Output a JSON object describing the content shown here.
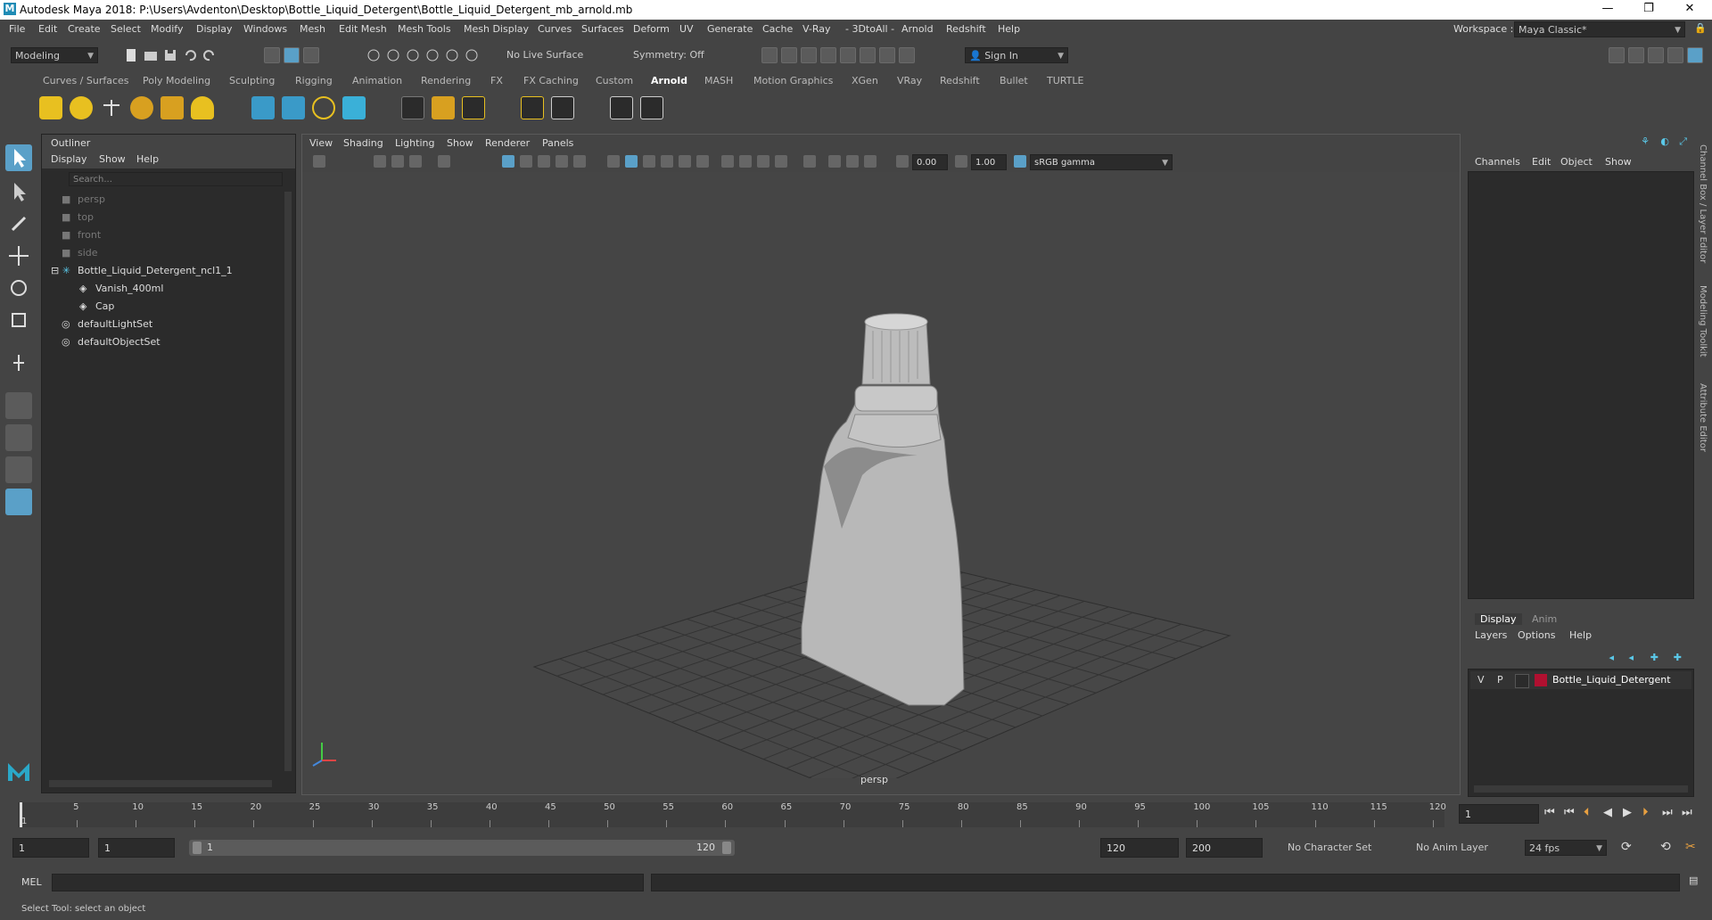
{
  "window": {
    "title": "Autodesk Maya 2018: P:\\Users\\Avdenton\\Desktop\\Bottle_Liquid_Detergent\\Bottle_Liquid_Detergent_mb_arnold.mb",
    "logo": "M",
    "minimize": "—",
    "maximize": "❐",
    "close": "✕"
  },
  "menubar": {
    "items": [
      "File",
      "Edit",
      "Create",
      "Select",
      "Modify",
      "Display",
      "Windows",
      "Mesh",
      "Edit Mesh",
      "Mesh Tools",
      "Mesh Display",
      "Curves",
      "Surfaces",
      "Deform",
      "UV",
      "Generate",
      "Cache",
      "V-Ray",
      "- 3DtoAll -",
      "Arnold",
      "Redshift",
      "Help"
    ],
    "workspace_label": "Workspace :",
    "workspace_value": "Maya Classic*"
  },
  "statusline": {
    "mode": "Modeling",
    "live_surface": "No Live Surface",
    "symmetry": "Symmetry: Off",
    "sign_in": "Sign In"
  },
  "shelf": {
    "tabs": [
      "Curves / Surfaces",
      "Poly Modeling",
      "Sculpting",
      "Rigging",
      "Animation",
      "Rendering",
      "FX",
      "FX Caching",
      "Custom",
      "Arnold",
      "MASH",
      "Motion Graphics",
      "XGen",
      "VRay",
      "Redshift",
      "Bullet",
      "TURTLE"
    ],
    "active_tab": "Arnold"
  },
  "outliner": {
    "title": "Outliner",
    "menus": [
      "Display",
      "Show",
      "Help"
    ],
    "search_placeholder": "Search...",
    "items": [
      {
        "label": "persp",
        "dim": true
      },
      {
        "label": "top",
        "dim": true
      },
      {
        "label": "front",
        "dim": true
      },
      {
        "label": "side",
        "dim": true
      },
      {
        "label": "Bottle_Liquid_Detergent_ncl1_1",
        "dim": false
      },
      {
        "label": "Vanish_400ml",
        "dim": false
      },
      {
        "label": "Cap",
        "dim": false
      },
      {
        "label": "defaultLightSet",
        "dim": false
      },
      {
        "label": "defaultObjectSet",
        "dim": false
      }
    ]
  },
  "viewport": {
    "menus": [
      "View",
      "Shading",
      "Lighting",
      "Show",
      "Renderer",
      "Panels"
    ],
    "exposure": "0.00",
    "gamma": "1.00",
    "color_space": "sRGB gamma",
    "camera_label": "persp"
  },
  "channelbox": {
    "menus": [
      "Channels",
      "Edit",
      "Object",
      "Show"
    ]
  },
  "layereditor": {
    "tabs": [
      "Display",
      "Anim"
    ],
    "active_tab": "Display",
    "menus": [
      "Layers",
      "Options",
      "Help"
    ],
    "layer": {
      "v": "V",
      "p": "P",
      "name": "Bottle_Liquid_Detergent",
      "color": "#b01030"
    }
  },
  "sidetabs": [
    "Channel Box / Layer Editor",
    "Modeling Toolkit",
    "Attribute Editor"
  ],
  "timeline": {
    "ticks": [
      "5",
      "10",
      "15",
      "20",
      "25",
      "30",
      "35",
      "40",
      "45",
      "50",
      "55",
      "60",
      "65",
      "70",
      "75",
      "80",
      "85",
      "90",
      "95",
      "100",
      "105",
      "110",
      "115",
      "120"
    ],
    "start_marker": "1",
    "current_frame": "1"
  },
  "range": {
    "start": "1",
    "playback_start": "1",
    "slider_start": "1",
    "slider_end": "120",
    "playback_end": "120",
    "end": "200",
    "character_set": "No Character Set",
    "anim_layer": "No Anim Layer",
    "fps": "24 fps"
  },
  "cmdline": {
    "label": "MEL"
  },
  "helpline": {
    "text": "Select Tool: select an object"
  },
  "colors": {
    "accent": "#5aa0c8",
    "panel_bg": "#444444",
    "field_bg": "#2b2b2b",
    "layer_color": "#b01030"
  }
}
